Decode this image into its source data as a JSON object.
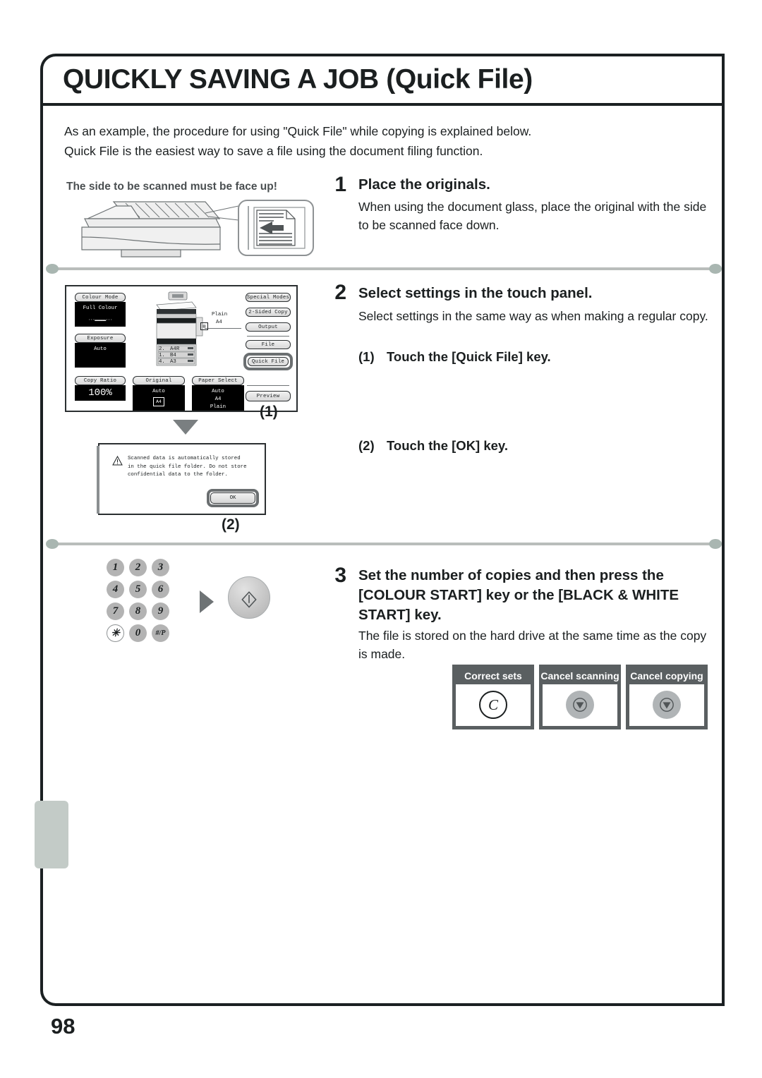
{
  "page": {
    "title": "QUICKLY SAVING A JOB (Quick File)",
    "number": "98"
  },
  "intro": {
    "line1": "As an example, the procedure for using \"Quick File\" while copying is explained below.",
    "line2": "Quick File is the easiest way to save a file using the document filing function."
  },
  "steps": [
    {
      "number": "1",
      "heading": "Place the originals.",
      "body": "When using the document glass, place the original with the side to be scanned face down.",
      "illustration_label": "The side to be scanned must be face up!"
    },
    {
      "number": "2",
      "heading": "Select settings in the touch panel.",
      "body": "Select settings in the same way as when making a regular copy.",
      "substeps": [
        {
          "marker": "(1)",
          "text": "Touch the [Quick File] key."
        },
        {
          "marker": "(2)",
          "text": "Touch the [OK] key."
        }
      ]
    },
    {
      "number": "3",
      "heading": "Set the number of copies and then press the [COLOUR START] key or the [BLACK & WHITE START] key.",
      "heading_lines": [
        "Set the number of copies and then press the",
        "[COLOUR START] key or the [BLACK & WHITE",
        "START] key."
      ],
      "body": "The file is stored on the hard drive at the same time as the copy is made."
    }
  ],
  "touch_panel": {
    "left_keys": [
      {
        "label": "Colour Mode",
        "value": "Full Colour"
      },
      {
        "label": "Exposure",
        "value": "Auto"
      },
      {
        "label": "Copy Ratio",
        "value": "100%"
      }
    ],
    "bottom_keys": [
      {
        "label": "Original",
        "values": [
          "Auto",
          "A4"
        ]
      },
      {
        "label": "Paper Select",
        "values": [
          "Auto",
          "A4",
          "Plain"
        ]
      }
    ],
    "right_keys": [
      "Special Modes",
      "2-Sided Copy",
      "Output",
      "File",
      "Quick File",
      "Preview"
    ],
    "machine_paper": {
      "type": "Plain",
      "size": "A4"
    },
    "trays": [
      {
        "no": "2.",
        "size": "A4R"
      },
      {
        "no": "1.",
        "size": "B4"
      },
      {
        "no": "4.",
        "size": "A3"
      }
    ],
    "callout_1": "(1)",
    "callout_2": "(2)"
  },
  "alert_dialog": {
    "lines": [
      "Scanned data is automatically stored",
      "in the quick file folder. Do not store",
      "confidential data to the folder."
    ],
    "ok_label": "OK"
  },
  "keypad": {
    "keys": [
      "1",
      "2",
      "3",
      "4",
      "5",
      "6",
      "7",
      "8",
      "9",
      "✳",
      "0",
      "#/P"
    ]
  },
  "control_boxes": [
    {
      "title": "Correct sets",
      "icon": "clear-c-icon",
      "glyph": "C"
    },
    {
      "title": "Cancel scanning",
      "icon": "stop-icon",
      "glyph": ""
    },
    {
      "title": "Cancel copying",
      "icon": "stop-icon",
      "glyph": ""
    }
  ],
  "colors": {
    "frame": "#1b2022",
    "separator": "#b9bdbb",
    "highlight": "#6b6f71",
    "control_header": "#5a5f61",
    "side_tab": "#c3cbc7"
  }
}
